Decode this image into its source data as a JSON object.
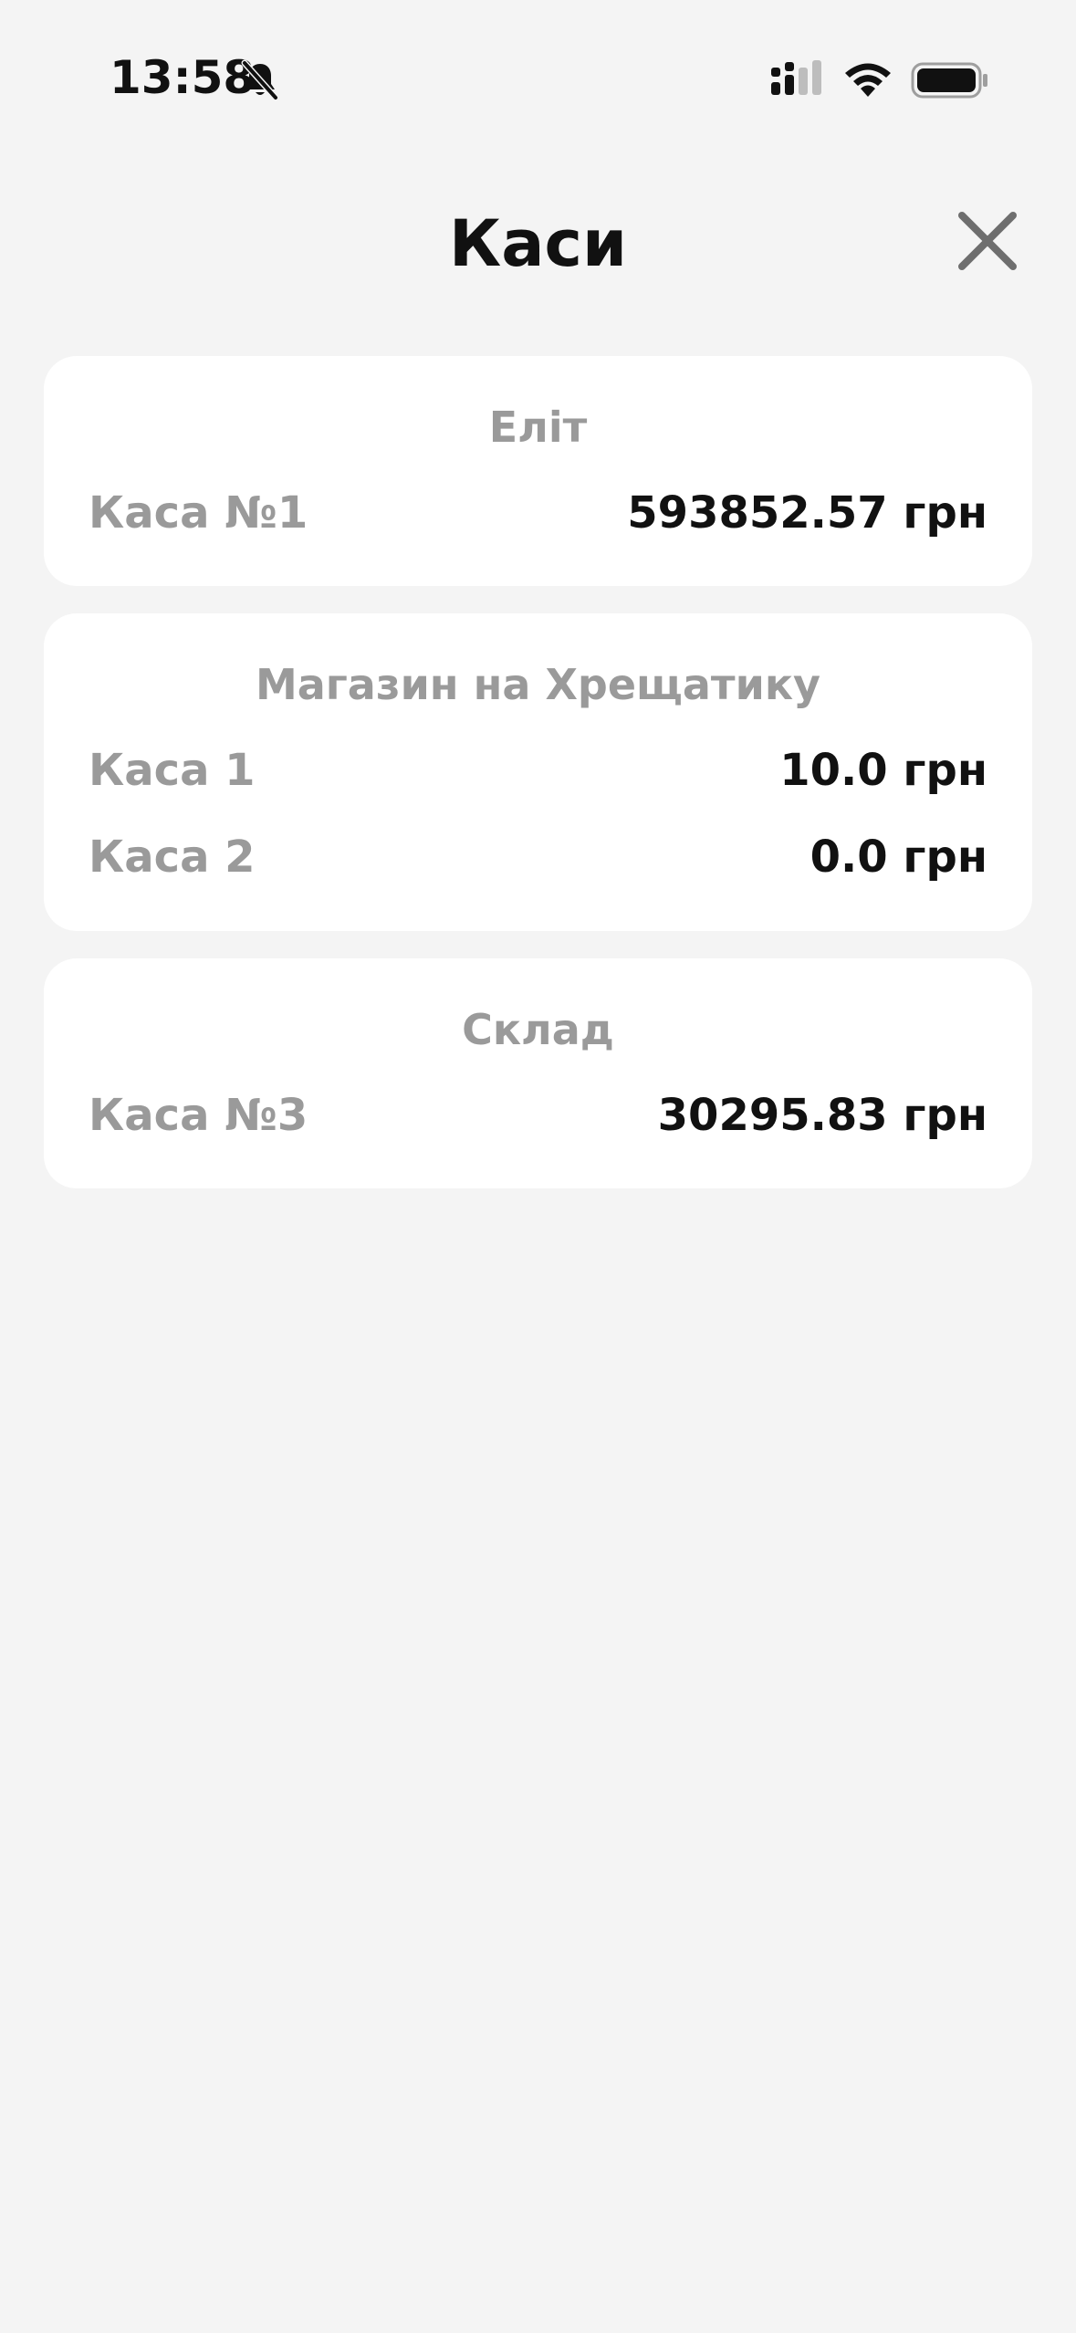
{
  "status_bar": {
    "time": "13:58",
    "icons": [
      "bell-slash-icon",
      "cellular-signal-icon",
      "wifi-icon",
      "battery-icon"
    ]
  },
  "header": {
    "title": "Каси",
    "close_icon": "close-icon"
  },
  "colors": {
    "background": "#f4f4f4",
    "card": "#ffffff",
    "muted_text": "#9a9a9a",
    "primary_text": "#111111",
    "close_icon": "#6e6e6e"
  },
  "groups": [
    {
      "name": "Еліт",
      "registers": [
        {
          "label": "Каса №1",
          "value": "593852.57 грн"
        }
      ]
    },
    {
      "name": "Магазин на Хрещатику",
      "registers": [
        {
          "label": "Каса 1",
          "value": "10.0 грн"
        },
        {
          "label": "Каса 2",
          "value": "0.0 грн"
        }
      ]
    },
    {
      "name": "Склад",
      "registers": [
        {
          "label": "Каса №3",
          "value": "30295.83 грн"
        }
      ]
    }
  ]
}
